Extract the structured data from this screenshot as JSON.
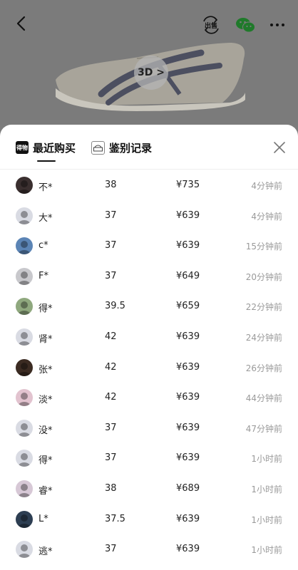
{
  "header": {
    "back_icon": "chevron-left-icon",
    "sell_label": "出售",
    "wechat_icon": "wechat-icon",
    "more_icon": "more-icon",
    "three_d_label": "3D >"
  },
  "sheet": {
    "tabs": [
      {
        "icon_label": "得物",
        "label": "最近购买",
        "active": true
      },
      {
        "icon_label": "",
        "label": "鉴别记录",
        "active": false
      }
    ],
    "close_icon": "close-icon",
    "rows": [
      {
        "buyer": "不*",
        "size": "38",
        "price": "¥735",
        "time": "4分钟前",
        "avatar_color": "#3a2f2f"
      },
      {
        "buyer": "大*",
        "size": "37",
        "price": "¥639",
        "time": "4分钟前",
        "avatar_color": "#d9dbe3"
      },
      {
        "buyer": "c*",
        "size": "37",
        "price": "¥639",
        "time": "15分钟前",
        "avatar_color": "#5b84b5"
      },
      {
        "buyer": "F*",
        "size": "37",
        "price": "¥649",
        "time": "20分钟前",
        "avatar_color": "#c8c8cc"
      },
      {
        "buyer": "得*",
        "size": "39.5",
        "price": "¥659",
        "time": "22分钟前",
        "avatar_color": "#8fa87e"
      },
      {
        "buyer": "肾*",
        "size": "42",
        "price": "¥639",
        "time": "24分钟前",
        "avatar_color": "#d9dbe3"
      },
      {
        "buyer": "张*",
        "size": "42",
        "price": "¥639",
        "time": "26分钟前",
        "avatar_color": "#3b2b22"
      },
      {
        "buyer": "淡*",
        "size": "42",
        "price": "¥639",
        "time": "44分钟前",
        "avatar_color": "#e2c3cf"
      },
      {
        "buyer": "没*",
        "size": "37",
        "price": "¥639",
        "time": "47分钟前",
        "avatar_color": "#d9dbe3"
      },
      {
        "buyer": "得*",
        "size": "37",
        "price": "¥639",
        "time": "1小时前",
        "avatar_color": "#d9dbe3"
      },
      {
        "buyer": "睿*",
        "size": "38",
        "price": "¥689",
        "time": "1小时前",
        "avatar_color": "#d7c8d6"
      },
      {
        "buyer": "L*",
        "size": "37.5",
        "price": "¥639",
        "time": "1小时前",
        "avatar_color": "#2d3e52"
      },
      {
        "buyer": "逃*",
        "size": "37",
        "price": "¥639",
        "time": "1小时前",
        "avatar_color": "#d9dbe3"
      }
    ]
  }
}
